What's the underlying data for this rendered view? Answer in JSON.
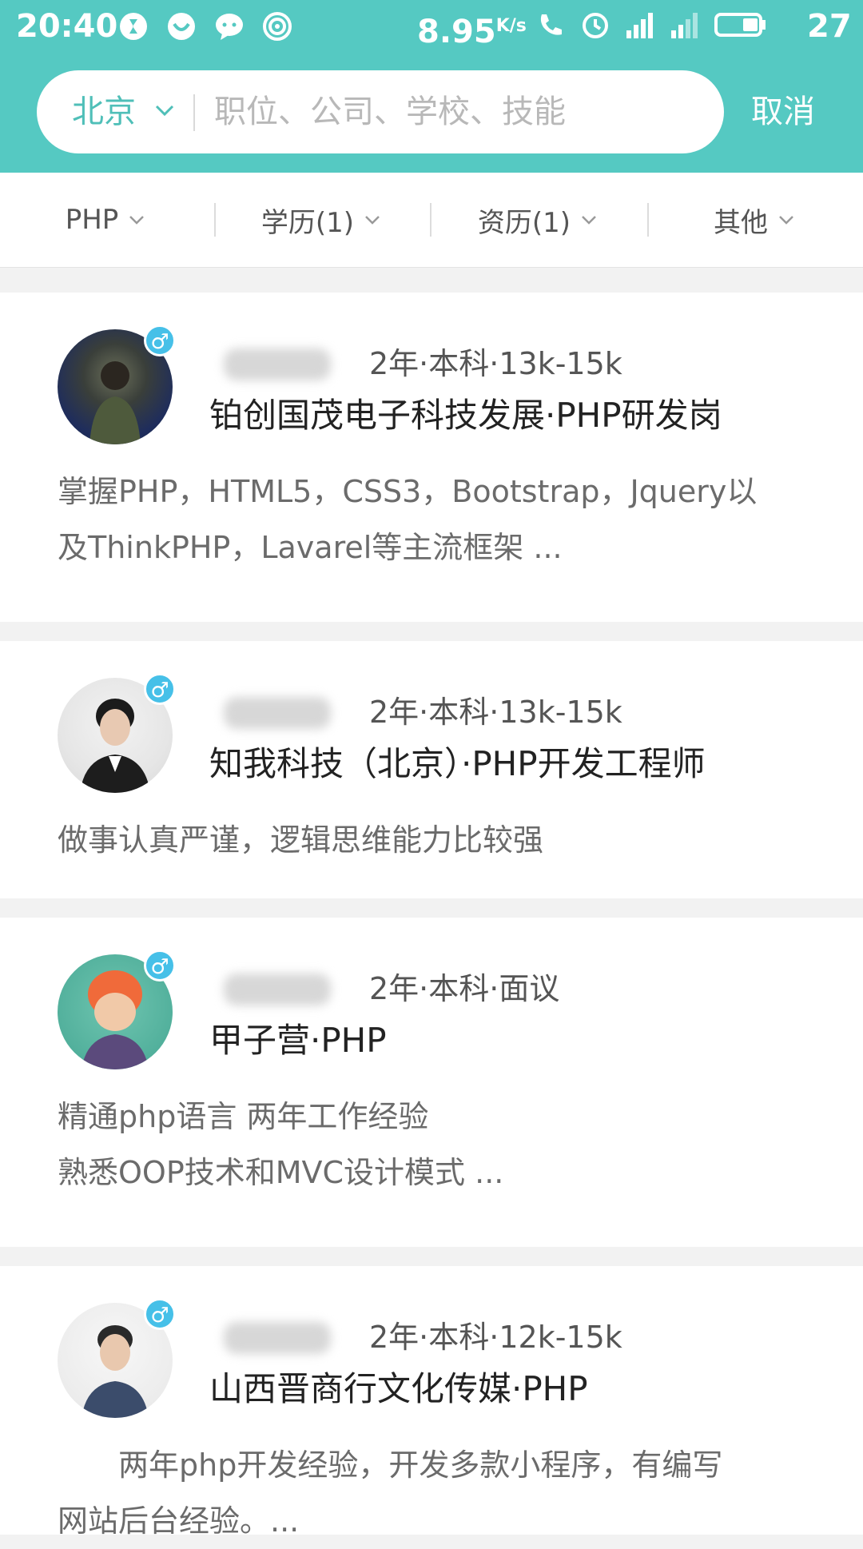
{
  "status_bar": {
    "time": "20:40",
    "net_speed": "8.95",
    "net_speed_unit": "K/s",
    "battery_level": "27"
  },
  "search": {
    "city": "北京",
    "placeholder": "职位、公司、学校、技能",
    "cancel_label": "取消"
  },
  "filters": [
    {
      "label": "PHP"
    },
    {
      "label": "学历(1)"
    },
    {
      "label": "资历(1)"
    },
    {
      "label": "其他"
    }
  ],
  "candidates": [
    {
      "meta": "2年·本科·13k-15k",
      "job": "铂创国茂电子科技发展·PHP研发岗",
      "desc": "掌握PHP，HTML5，CSS3，Bootstrap，Jquery以\n及ThinkPHP，Lavarel等主流框架 ...",
      "gender": "♂"
    },
    {
      "meta": "2年·本科·13k-15k",
      "job": "知我科技（北京）·PHP开发工程师",
      "desc": "做事认真严谨，逻辑思维能力比较强",
      "gender": "♂"
    },
    {
      "meta": "2年·本科·面议",
      "job": "甲子营·PHP",
      "desc": "精通php语言 两年工作经验\n熟悉OOP技术和MVC设计模式 ...",
      "gender": "♂"
    },
    {
      "meta": "2年·本科·12k-15k",
      "job": "山西晋商行文化传媒·PHP",
      "desc": "　　两年php开发经验，开发多款小程序，有编写\n网站后台经验。...",
      "gender": "♂"
    }
  ],
  "colors": {
    "header": "#55c9c2",
    "accent": "#4fbfb8",
    "gender_badge": "#46c0e8"
  }
}
